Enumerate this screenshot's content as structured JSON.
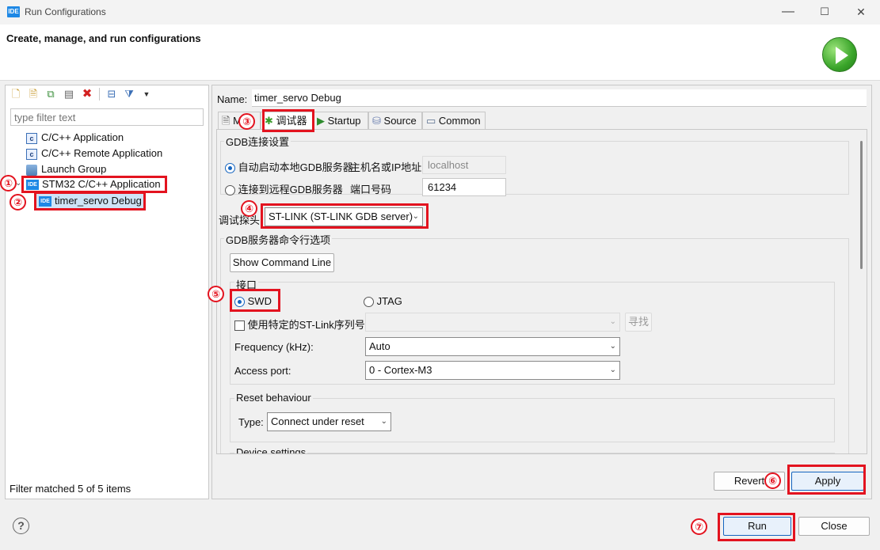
{
  "window": {
    "app_icon_text": "IDE",
    "title": "Run Configurations",
    "min_glyph": "—",
    "max_glyph": "☐",
    "close_glyph": "✕"
  },
  "header": {
    "title": "Create, manage, and run configurations"
  },
  "left": {
    "filter_placeholder": "type filter text",
    "toolbar_icons": [
      "new-config-icon",
      "new-prototype-icon",
      "duplicate-icon",
      "export-icon",
      "delete-icon",
      "collapse-all-icon",
      "filter-icon",
      "dropdown-icon"
    ],
    "tree": [
      {
        "icon": "c",
        "label": "C/C++ Application"
      },
      {
        "icon": "c",
        "label": "C/C++ Remote Application"
      },
      {
        "icon": "launch",
        "label": "Launch Group"
      },
      {
        "icon": "IDE",
        "label": "STM32 C/C++ Application",
        "expanded": true
      },
      {
        "icon": "IDE",
        "label": "timer_servo Debug",
        "child": true,
        "selected": true
      }
    ],
    "status": "Filter matched 5 of 5 items"
  },
  "right": {
    "name_label": "Name:",
    "name_value": "timer_servo Debug",
    "tabs": [
      {
        "label": "Main",
        "icon": "main-icon"
      },
      {
        "label": "调试器",
        "icon": "debugger-icon",
        "active": true
      },
      {
        "label": "Startup",
        "icon": "startup-icon"
      },
      {
        "label": "Source",
        "icon": "source-icon"
      },
      {
        "label": "Common",
        "icon": "common-icon"
      }
    ],
    "gdb_group": {
      "title": "GDB连接设置",
      "auto_label": "自动启动本地GDB服务器",
      "host_label": "主机名或IP地址",
      "host_value": "localhost",
      "remote_label": "连接到远程GDB服务器",
      "port_label": "端口号码",
      "port_value": "61234"
    },
    "probe_label": "调试探头",
    "probe_value": "ST-LINK (ST-LINK GDB server)",
    "server_options_title": "GDB服务器命令行选项",
    "show_cmd_button": "Show Command Line",
    "interface": {
      "title": "接口",
      "swd_label": "SWD",
      "jtag_label": "JTAG",
      "serial_check_label": "使用特定的ST-Link序列号",
      "find_button": "寻找",
      "frequency_label": "Frequency (kHz):",
      "frequency_value": "Auto",
      "access_port_label": "Access port:",
      "access_port_value": "0 - Cortex-M3"
    },
    "reset": {
      "title": "Reset behaviour",
      "type_label": "Type:",
      "type_value": "Connect under reset"
    },
    "device_settings_title": "Device settings",
    "revert_button": "Revert",
    "apply_button": "Apply"
  },
  "footer": {
    "help_glyph": "?",
    "run_button": "Run",
    "close_button": "Close"
  },
  "annotations": [
    "①",
    "②",
    "③",
    "④",
    "⑤",
    "⑥",
    "⑦"
  ],
  "colors": {
    "annotation_red": "#e3131f",
    "ide_blue": "#1e88e5",
    "radio_blue": "#1565c0"
  }
}
